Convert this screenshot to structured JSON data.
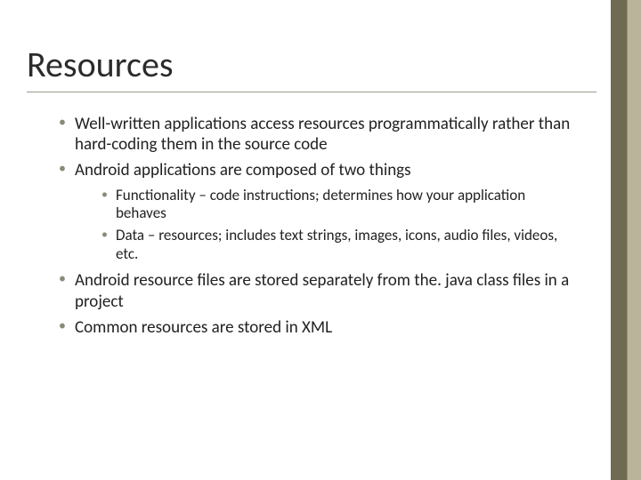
{
  "title": "Resources",
  "bullets": {
    "b1": "Well-written applications access resources programmatically rather than hard-coding them in the source code",
    "b2": "Android applications are composed of two things",
    "b2_sub1": "Functionality – code instructions; determines how your application behaves",
    "b2_sub2": "Data – resources; includes text strings, images, icons, audio files, videos, etc.",
    "b3": "Android resource files are stored separately from the. java class files in a project",
    "b4": "Common resources are stored in XML"
  }
}
